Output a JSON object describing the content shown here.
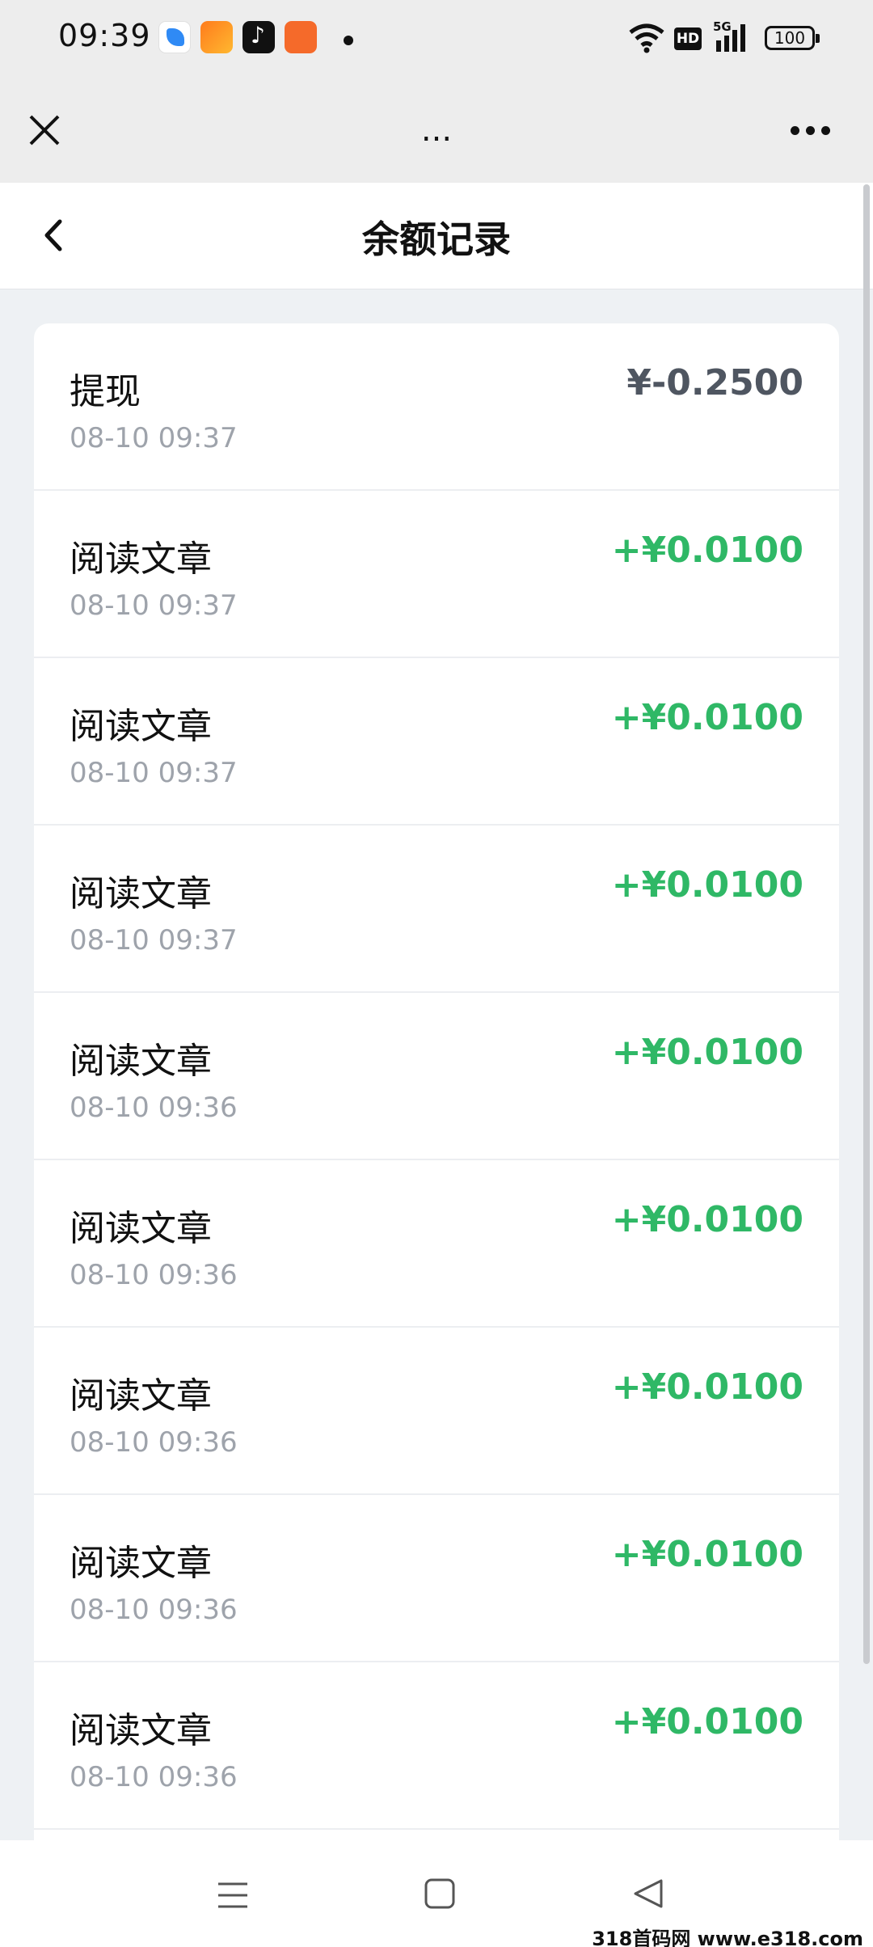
{
  "status_bar": {
    "time": "09:39",
    "network": "5G",
    "hd": "HD",
    "battery": "100"
  },
  "webview": {
    "title": "...",
    "close_icon": "close-icon",
    "more_icon": "more-dots-icon"
  },
  "header": {
    "title": "余额记录",
    "back_icon": "chevron-left-icon"
  },
  "colors": {
    "positive": "#2fb866",
    "negative": "#4f5661",
    "background": "#eef1f4"
  },
  "records": [
    {
      "title": "提现",
      "time": "08-10 09:37",
      "amount": "¥-0.2500",
      "kind": "neg"
    },
    {
      "title": "阅读文章",
      "time": "08-10 09:37",
      "amount": "+¥0.0100",
      "kind": "pos"
    },
    {
      "title": "阅读文章",
      "time": "08-10 09:37",
      "amount": "+¥0.0100",
      "kind": "pos"
    },
    {
      "title": "阅读文章",
      "time": "08-10 09:37",
      "amount": "+¥0.0100",
      "kind": "pos"
    },
    {
      "title": "阅读文章",
      "time": "08-10 09:36",
      "amount": "+¥0.0100",
      "kind": "pos"
    },
    {
      "title": "阅读文章",
      "time": "08-10 09:36",
      "amount": "+¥0.0100",
      "kind": "pos"
    },
    {
      "title": "阅读文章",
      "time": "08-10 09:36",
      "amount": "+¥0.0100",
      "kind": "pos"
    },
    {
      "title": "阅读文章",
      "time": "08-10 09:36",
      "amount": "+¥0.0100",
      "kind": "pos"
    },
    {
      "title": "阅读文章",
      "time": "08-10 09:36",
      "amount": "+¥0.0100",
      "kind": "pos"
    }
  ],
  "nav_bar": {
    "menu_icon": "menu-icon",
    "home_icon": "home-square-icon",
    "back_icon": "back-triangle-icon"
  },
  "watermark": "318首码网 www.e318.com"
}
